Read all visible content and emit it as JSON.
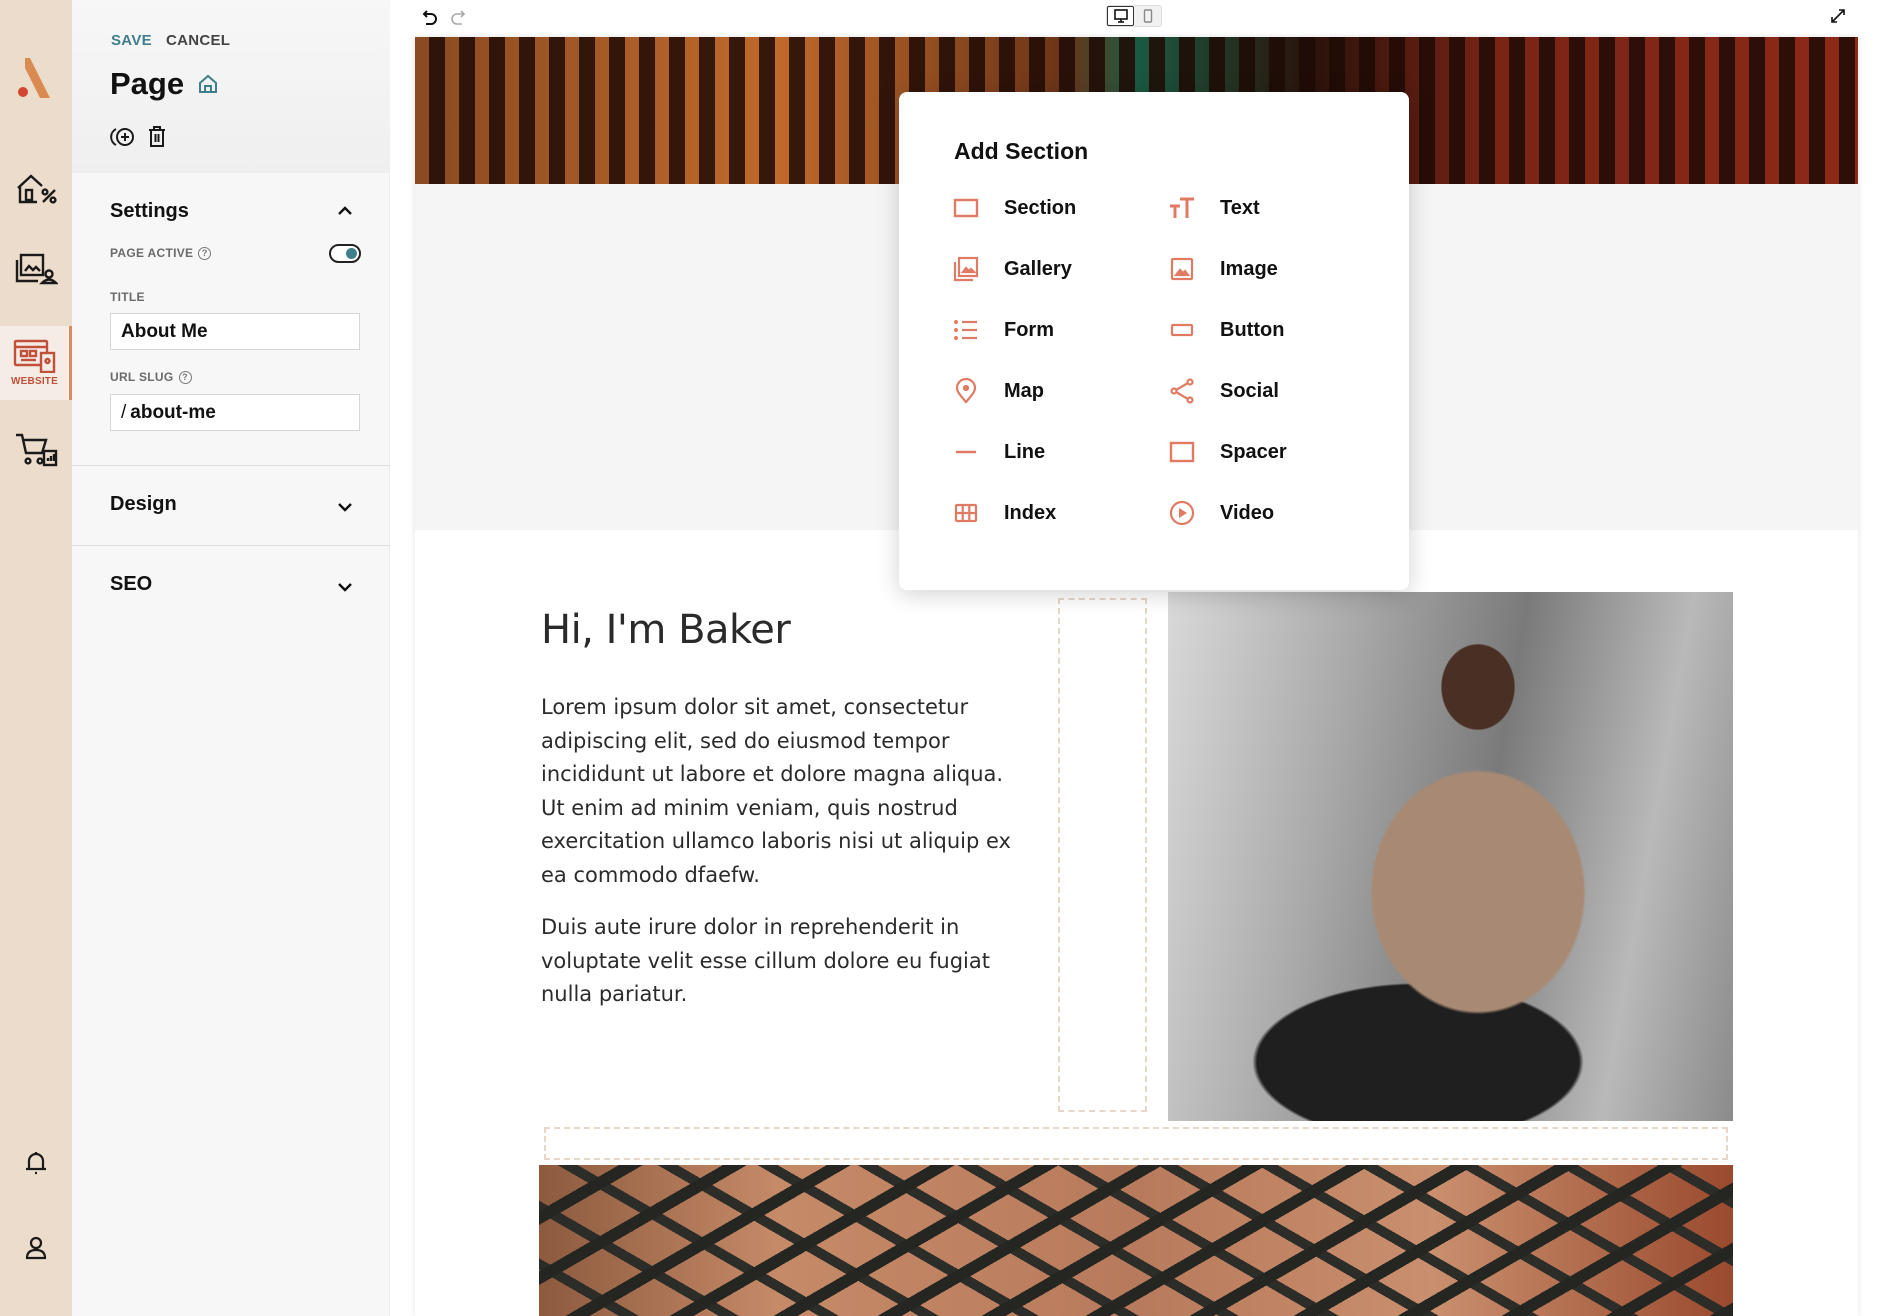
{
  "rail": {
    "logo": "brand-logo",
    "items": [
      {
        "name": "properties",
        "icon": "house-percent-icon"
      },
      {
        "name": "media",
        "icon": "gallery-user-icon"
      },
      {
        "name": "website",
        "icon": "website-devices-icon",
        "label": "WEBSITE",
        "active": true
      },
      {
        "name": "store",
        "icon": "cart-chart-icon"
      }
    ],
    "bottom": [
      {
        "name": "notifications",
        "icon": "bell-icon"
      },
      {
        "name": "account",
        "icon": "user-icon"
      }
    ]
  },
  "panel": {
    "save_label": "SAVE",
    "cancel_label": "CANCEL",
    "title": "Page",
    "settings": {
      "heading": "Settings",
      "page_active_label": "PAGE ACTIVE",
      "page_active": true,
      "title_label": "TITLE",
      "title_value": "About Me",
      "slug_label": "URL SLUG",
      "slug_prefix": "/",
      "slug_value": "about-me"
    },
    "design_heading": "Design",
    "seo_heading": "SEO"
  },
  "toolbar": {
    "device_selected": "desktop"
  },
  "popup": {
    "title": "Add Section",
    "items": [
      {
        "label": "Section",
        "icon": "section-icon"
      },
      {
        "label": "Text",
        "icon": "text-icon"
      },
      {
        "label": "Gallery",
        "icon": "gallery-icon"
      },
      {
        "label": "Image",
        "icon": "image-icon"
      },
      {
        "label": "Form",
        "icon": "form-icon"
      },
      {
        "label": "Button",
        "icon": "button-icon"
      },
      {
        "label": "Map",
        "icon": "map-pin-icon"
      },
      {
        "label": "Social",
        "icon": "share-icon"
      },
      {
        "label": "Line",
        "icon": "line-icon"
      },
      {
        "label": "Spacer",
        "icon": "spacer-icon"
      },
      {
        "label": "Index",
        "icon": "grid-icon"
      },
      {
        "label": "Video",
        "icon": "play-icon"
      }
    ],
    "accent": "#e07a62"
  },
  "page": {
    "heading": "Hi, I'm Baker",
    "paragraphs": [
      "Lorem ipsum dolor sit amet, consectetur adipiscing elit, sed do eiusmod tempor incididunt ut labore et dolore magna aliqua. Ut enim ad minim veniam, quis nostrud exercitation ullamco laboris nisi ut aliquip ex ea commodo dfaefw.",
      "Duis aute irure dolor in reprehenderit in voluptate velit esse cillum dolore eu fugiat nulla pariatur."
    ]
  },
  "help": {
    "icon": "help-icon",
    "symbol": "?"
  },
  "colors": {
    "rail_bg": "#ecdccb",
    "accent_teal": "#3f7f8c",
    "accent_coral": "#e07a62",
    "active_red": "#c0503a"
  }
}
